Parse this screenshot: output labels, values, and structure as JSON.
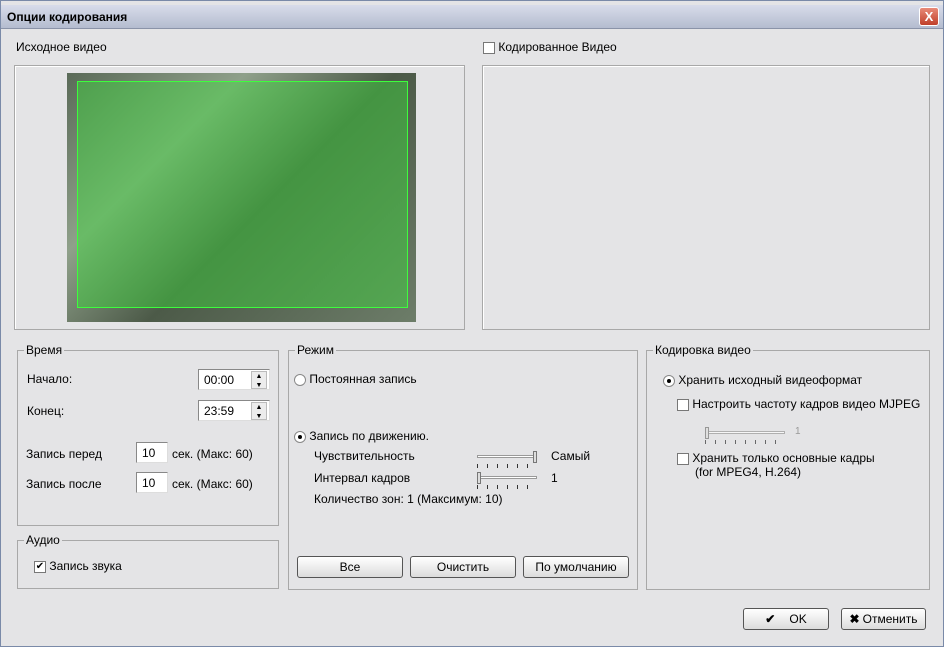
{
  "window": {
    "title": "Опции кодирования",
    "close": "X"
  },
  "source": {
    "label": "Исходное видео"
  },
  "encoded": {
    "label": "Кодированное Видео",
    "checked": false
  },
  "time": {
    "legend": "Время",
    "start_label": "Начало:",
    "start_value": "00:00",
    "end_label": "Конец:",
    "end_value": "23:59",
    "pre_label": "Запись перед",
    "pre_value": "10",
    "pre_suffix": "сек. (Макс: 60)",
    "post_label": "Запись после",
    "post_value": "10",
    "post_suffix": "сек. (Макс: 60)"
  },
  "audio": {
    "legend": "Аудио",
    "record_label": "Запись звука",
    "checked": true
  },
  "mode": {
    "legend": "Режим",
    "continuous": "Постоянная запись",
    "motion": "Запись по движению.",
    "sensitivity_label": "Чувствительность",
    "sensitivity_value": "Самый",
    "sensitivity_level": 1.0,
    "interval_label": "Интервал кадров",
    "interval_value": "1",
    "interval_level": 0.0,
    "zones": "Количество зон: 1  (Максимум: 10)",
    "buttons": {
      "all": "Все",
      "clear": "Очистить",
      "default": "По умолчанию"
    }
  },
  "encoding": {
    "legend": "Кодировка видео",
    "keep_format": "Хранить исходный видеоформат",
    "mjpeg_label": "Настроить частоту кадров видео MJPEG",
    "mjpeg_value": "1",
    "keyframes_line1": "Хранить только основные кадры",
    "keyframes_line2": "(for MPEG4, H.264)"
  },
  "footer": {
    "ok": "OK",
    "cancel": "Отменить"
  }
}
